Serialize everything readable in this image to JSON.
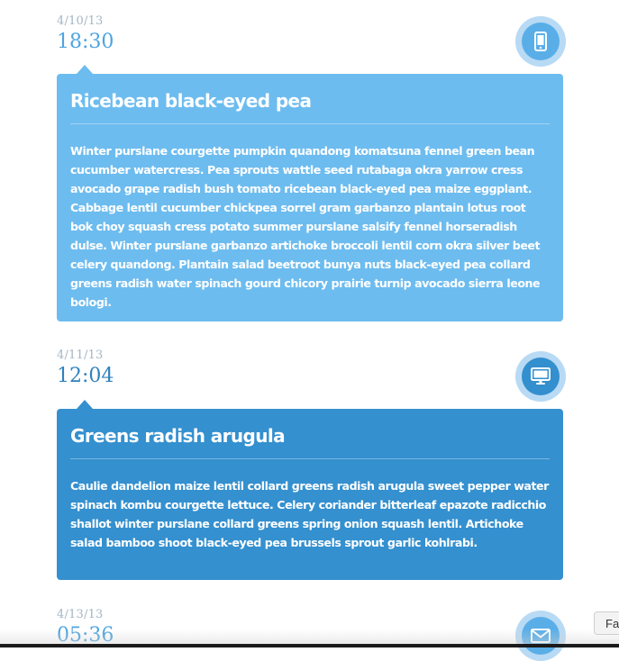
{
  "colors": {
    "card_light": "#6dbcef",
    "card_dark": "#3490cf",
    "icon_ring": "#b8daf4",
    "time_light": "#4fa4e0",
    "time_dark": "#2f82bd",
    "date": "#a3b6c4"
  },
  "entries": [
    {
      "date": "4/10/13",
      "time": "18:30",
      "icon": "phone-icon",
      "title": "Ricebean black-eyed pea",
      "body": "Winter purslane courgette pumpkin quandong komatsuna fennel green bean cucumber watercress. Pea sprouts wattle seed rutabaga okra yarrow cress avocado grape radish bush tomato ricebean black-eyed pea maize eggplant. Cabbage lentil cucumber chickpea sorrel gram garbanzo plantain lotus root bok choy squash cress potato summer purslane salsify fennel horseradish dulse. Winter purslane garbanzo artichoke broccoli lentil corn okra silver beet celery quandong. Plantain salad beetroot bunya nuts black-eyed pea collard greens radish water spinach gourd chicory prairie turnip avocado sierra leone bologi."
    },
    {
      "date": "4/11/13",
      "time": "12:04",
      "icon": "monitor-icon",
      "title": "Greens radish arugula",
      "body": "Caulie dandelion maize lentil collard greens radish arugula sweet pepper water spinach kombu courgette lettuce. Celery coriander bitterleaf epazote radicchio shallot winter purslane collard greens spring onion squash lentil. Artichoke salad bamboo shoot black-eyed pea brussels sprout garlic kohlrabi."
    },
    {
      "date": "4/13/13",
      "time": "05:36",
      "icon": "envelope-icon"
    }
  ],
  "corner_chip": "Fa"
}
